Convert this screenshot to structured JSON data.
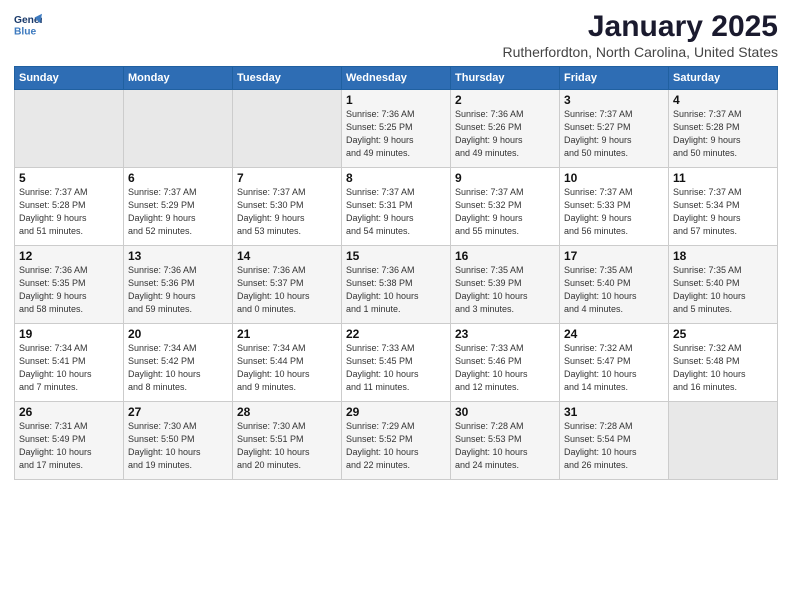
{
  "logo": {
    "line1": "General",
    "line2": "Blue"
  },
  "title": "January 2025",
  "location": "Rutherfordton, North Carolina, United States",
  "weekdays": [
    "Sunday",
    "Monday",
    "Tuesday",
    "Wednesday",
    "Thursday",
    "Friday",
    "Saturday"
  ],
  "weeks": [
    [
      {
        "day": "",
        "info": ""
      },
      {
        "day": "",
        "info": ""
      },
      {
        "day": "",
        "info": ""
      },
      {
        "day": "1",
        "info": "Sunrise: 7:36 AM\nSunset: 5:25 PM\nDaylight: 9 hours\nand 49 minutes."
      },
      {
        "day": "2",
        "info": "Sunrise: 7:36 AM\nSunset: 5:26 PM\nDaylight: 9 hours\nand 49 minutes."
      },
      {
        "day": "3",
        "info": "Sunrise: 7:37 AM\nSunset: 5:27 PM\nDaylight: 9 hours\nand 50 minutes."
      },
      {
        "day": "4",
        "info": "Sunrise: 7:37 AM\nSunset: 5:28 PM\nDaylight: 9 hours\nand 50 minutes."
      }
    ],
    [
      {
        "day": "5",
        "info": "Sunrise: 7:37 AM\nSunset: 5:28 PM\nDaylight: 9 hours\nand 51 minutes."
      },
      {
        "day": "6",
        "info": "Sunrise: 7:37 AM\nSunset: 5:29 PM\nDaylight: 9 hours\nand 52 minutes."
      },
      {
        "day": "7",
        "info": "Sunrise: 7:37 AM\nSunset: 5:30 PM\nDaylight: 9 hours\nand 53 minutes."
      },
      {
        "day": "8",
        "info": "Sunrise: 7:37 AM\nSunset: 5:31 PM\nDaylight: 9 hours\nand 54 minutes."
      },
      {
        "day": "9",
        "info": "Sunrise: 7:37 AM\nSunset: 5:32 PM\nDaylight: 9 hours\nand 55 minutes."
      },
      {
        "day": "10",
        "info": "Sunrise: 7:37 AM\nSunset: 5:33 PM\nDaylight: 9 hours\nand 56 minutes."
      },
      {
        "day": "11",
        "info": "Sunrise: 7:37 AM\nSunset: 5:34 PM\nDaylight: 9 hours\nand 57 minutes."
      }
    ],
    [
      {
        "day": "12",
        "info": "Sunrise: 7:36 AM\nSunset: 5:35 PM\nDaylight: 9 hours\nand 58 minutes."
      },
      {
        "day": "13",
        "info": "Sunrise: 7:36 AM\nSunset: 5:36 PM\nDaylight: 9 hours\nand 59 minutes."
      },
      {
        "day": "14",
        "info": "Sunrise: 7:36 AM\nSunset: 5:37 PM\nDaylight: 10 hours\nand 0 minutes."
      },
      {
        "day": "15",
        "info": "Sunrise: 7:36 AM\nSunset: 5:38 PM\nDaylight: 10 hours\nand 1 minute."
      },
      {
        "day": "16",
        "info": "Sunrise: 7:35 AM\nSunset: 5:39 PM\nDaylight: 10 hours\nand 3 minutes."
      },
      {
        "day": "17",
        "info": "Sunrise: 7:35 AM\nSunset: 5:40 PM\nDaylight: 10 hours\nand 4 minutes."
      },
      {
        "day": "18",
        "info": "Sunrise: 7:35 AM\nSunset: 5:40 PM\nDaylight: 10 hours\nand 5 minutes."
      }
    ],
    [
      {
        "day": "19",
        "info": "Sunrise: 7:34 AM\nSunset: 5:41 PM\nDaylight: 10 hours\nand 7 minutes."
      },
      {
        "day": "20",
        "info": "Sunrise: 7:34 AM\nSunset: 5:42 PM\nDaylight: 10 hours\nand 8 minutes."
      },
      {
        "day": "21",
        "info": "Sunrise: 7:34 AM\nSunset: 5:44 PM\nDaylight: 10 hours\nand 9 minutes."
      },
      {
        "day": "22",
        "info": "Sunrise: 7:33 AM\nSunset: 5:45 PM\nDaylight: 10 hours\nand 11 minutes."
      },
      {
        "day": "23",
        "info": "Sunrise: 7:33 AM\nSunset: 5:46 PM\nDaylight: 10 hours\nand 12 minutes."
      },
      {
        "day": "24",
        "info": "Sunrise: 7:32 AM\nSunset: 5:47 PM\nDaylight: 10 hours\nand 14 minutes."
      },
      {
        "day": "25",
        "info": "Sunrise: 7:32 AM\nSunset: 5:48 PM\nDaylight: 10 hours\nand 16 minutes."
      }
    ],
    [
      {
        "day": "26",
        "info": "Sunrise: 7:31 AM\nSunset: 5:49 PM\nDaylight: 10 hours\nand 17 minutes."
      },
      {
        "day": "27",
        "info": "Sunrise: 7:30 AM\nSunset: 5:50 PM\nDaylight: 10 hours\nand 19 minutes."
      },
      {
        "day": "28",
        "info": "Sunrise: 7:30 AM\nSunset: 5:51 PM\nDaylight: 10 hours\nand 20 minutes."
      },
      {
        "day": "29",
        "info": "Sunrise: 7:29 AM\nSunset: 5:52 PM\nDaylight: 10 hours\nand 22 minutes."
      },
      {
        "day": "30",
        "info": "Sunrise: 7:28 AM\nSunset: 5:53 PM\nDaylight: 10 hours\nand 24 minutes."
      },
      {
        "day": "31",
        "info": "Sunrise: 7:28 AM\nSunset: 5:54 PM\nDaylight: 10 hours\nand 26 minutes."
      },
      {
        "day": "",
        "info": ""
      }
    ]
  ]
}
